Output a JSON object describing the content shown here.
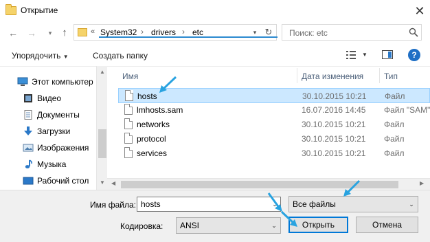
{
  "window": {
    "title": "Открытие",
    "close_glyph": "✕"
  },
  "nav": {
    "back_glyph": "←",
    "forward_glyph": "→",
    "dropdown_glyph": "▾",
    "up_glyph": "↑"
  },
  "address": {
    "chevron": "«",
    "crumbs": [
      "System32",
      "drivers",
      "etc"
    ],
    "separator": "›",
    "dropdown_glyph": "▾",
    "refresh_glyph": "↻"
  },
  "search": {
    "placeholder": "Поиск: etc"
  },
  "toolbar": {
    "organize_label": "Упорядочить",
    "organize_caret": "▼",
    "new_folder_label": "Создать папку",
    "view_caret": "▼",
    "help_label": "?"
  },
  "sidebar": {
    "items": [
      {
        "label": "Этот компьютер",
        "icon": "computer-icon"
      },
      {
        "label": "Видео",
        "icon": "video-icon"
      },
      {
        "label": "Документы",
        "icon": "documents-icon"
      },
      {
        "label": "Загрузки",
        "icon": "downloads-icon"
      },
      {
        "label": "Изображения",
        "icon": "pictures-icon"
      },
      {
        "label": "Музыка",
        "icon": "music-icon"
      },
      {
        "label": "Рабочий стол",
        "icon": "desktop-icon"
      }
    ],
    "scroll_up": "▲",
    "scroll_down": "▼"
  },
  "filelist": {
    "columns": [
      "Имя",
      "Дата изменения",
      "Тип"
    ],
    "rows": [
      {
        "name": "hosts",
        "date": "30.10.2015 10:21",
        "type": "Файл",
        "selected": true
      },
      {
        "name": "lmhosts.sam",
        "date": "16.07.2016 14:45",
        "type": "Файл \"SAM\"",
        "selected": false
      },
      {
        "name": "networks",
        "date": "30.10.2015 10:21",
        "type": "Файл",
        "selected": false
      },
      {
        "name": "protocol",
        "date": "30.10.2015 10:21",
        "type": "Файл",
        "selected": false
      },
      {
        "name": "services",
        "date": "30.10.2015 10:21",
        "type": "Файл",
        "selected": false
      }
    ],
    "scroll_left": "◀",
    "scroll_right": "▶"
  },
  "bottom": {
    "filename_label": "Имя файла:",
    "filename_value": "hosts",
    "filter_value": "Все файлы",
    "encoding_label": "Кодировка:",
    "encoding_value": "ANSI",
    "open_button": "Открыть",
    "cancel_button": "Отмена",
    "dropdown_glyph": "⌄"
  },
  "colors": {
    "accent": "#0078d7",
    "selection": "#cce8ff",
    "annotation_arrow": "#29a3e0"
  }
}
